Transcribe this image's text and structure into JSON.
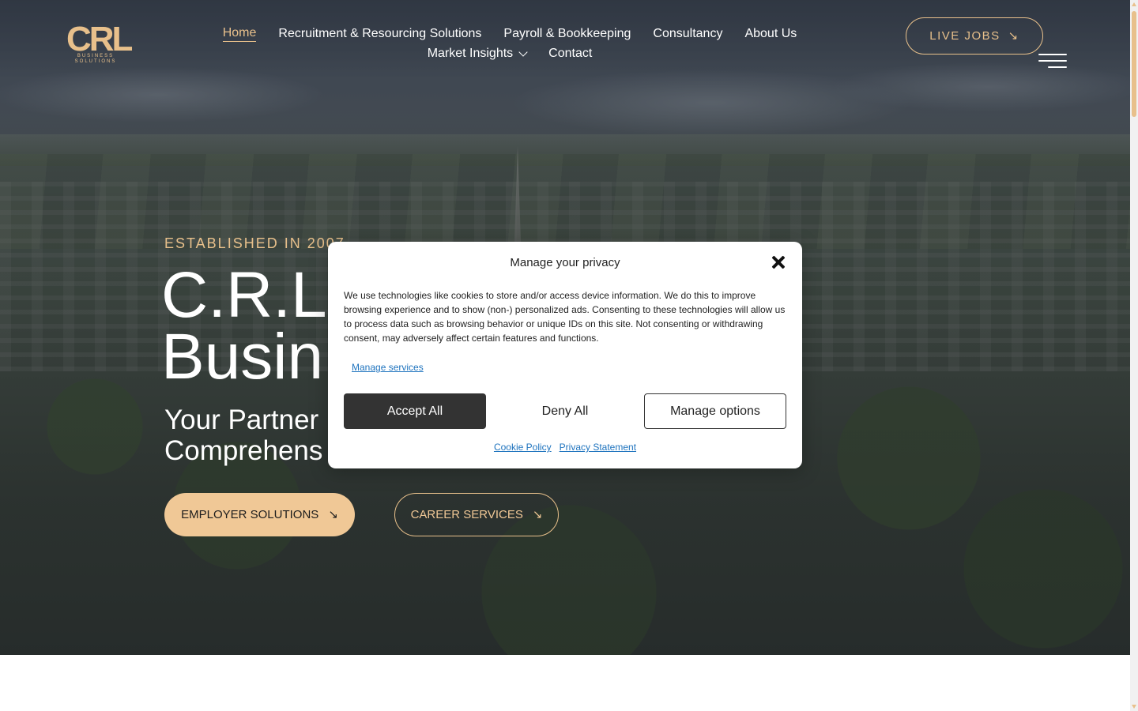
{
  "brand": {
    "logo_mark": "CRL",
    "logo_sub": "BUSINESS SOLUTIONS",
    "accent_color": "#e8c08b"
  },
  "nav": {
    "items": [
      {
        "label": "Home",
        "active": true
      },
      {
        "label": "Recruitment & Resourcing Solutions"
      },
      {
        "label": "Payroll & Bookkeeping"
      },
      {
        "label": "Consultancy"
      },
      {
        "label": "About Us"
      },
      {
        "label": "Market Insights",
        "icon": "chevron-down-icon"
      },
      {
        "label": "Contact"
      }
    ],
    "live_jobs_label": "LIVE JOBS",
    "live_jobs_icon": "arrow-down-right-icon",
    "menu_icon": "hamburger-menu-icon"
  },
  "hero": {
    "established": "ESTABLISHED IN 2007",
    "title_line1": "C.R.L",
    "title_line2": "Busin",
    "subtitle_line1": "Your Partner",
    "subtitle_line2": "Comprehens",
    "employer_button": "EMPLOYER SOLUTIONS",
    "career_button": "CAREER SERVICES",
    "button_icon": "arrow-down-right-icon"
  },
  "privacy_modal": {
    "title": "Manage your privacy",
    "close_icon": "close-icon",
    "body": "We use technologies like cookies to store and/or access device information. We do this to improve browsing experience and to show (non-) personalized ads. Consenting to these technologies will allow us to process data such as browsing behavior or unique IDs on this site. Not consenting or withdrawing consent, may adversely affect certain features and functions.",
    "manage_services": "Manage services",
    "accept_all": "Accept All",
    "deny_all": "Deny All",
    "manage_options": "Manage options",
    "cookie_policy": "Cookie Policy",
    "privacy_statement": "Privacy Statement"
  }
}
